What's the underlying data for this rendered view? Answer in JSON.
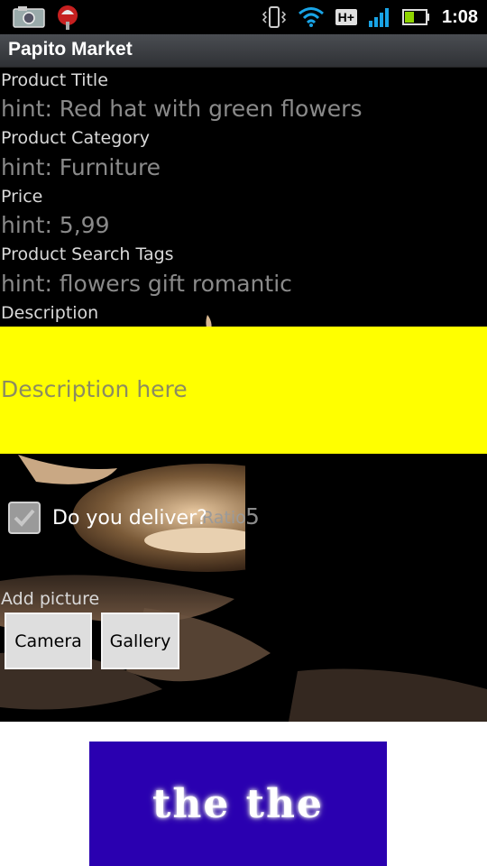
{
  "statusbar": {
    "clock": "1:08",
    "network_badge": "H+",
    "icons": [
      "photo-icon",
      "android-debug-icon",
      "vibrate-icon",
      "wifi-icon",
      "signal-icon",
      "battery-icon"
    ]
  },
  "app": {
    "title": "Papito Market"
  },
  "form": {
    "product_title": {
      "label": "Product Title",
      "hint": "hint: Red hat with green flowers"
    },
    "product_category": {
      "label": "Product Category",
      "hint": "hint: Furniture"
    },
    "price": {
      "label": "Price",
      "hint": "hint: 5,99"
    },
    "search_tags": {
      "label": "Product Search Tags",
      "hint": "hint: flowers gift romantic"
    },
    "description": {
      "label": "Description",
      "placeholder": "Description here"
    },
    "deliver": {
      "label": "Do you deliver?",
      "checked": true
    },
    "ratio": {
      "label": "Ratio",
      "value": "5"
    },
    "add_picture": {
      "label": "Add picture",
      "camera_button": "Camera",
      "gallery_button": "Gallery"
    }
  },
  "ad": {
    "text": "the the"
  },
  "colors": {
    "description_bg": "#ffff00",
    "ad_bg": "#2a00b0",
    "titlebar_bg": "#3a3c40"
  }
}
